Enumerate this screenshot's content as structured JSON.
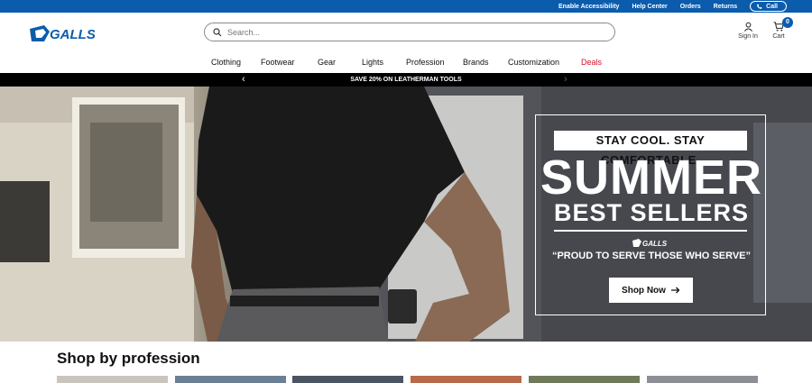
{
  "topbar": {
    "links": [
      "Enable Accessibility",
      "Help Center",
      "Orders",
      "Returns"
    ],
    "call_label": "Call"
  },
  "header": {
    "logo_text": "GALLS",
    "search_placeholder": "Search...",
    "signin_label": "Sign In",
    "cart_label": "Cart",
    "cart_count": "0"
  },
  "nav": {
    "items": [
      "Clothing",
      "Footwear",
      "Gear",
      "Lights",
      "Profession",
      "Brands",
      "Customization",
      "Deals"
    ],
    "deals_color": "#d0112b"
  },
  "promo": {
    "text": "SAVE 20% ON LEATHERMAN TOOLS"
  },
  "hero": {
    "tagline": "STAY COOL. STAY COMFORTABLE.",
    "headline": "SUMMER",
    "subheadline": "BEST SELLERS",
    "brand": "GALLS",
    "slogan": "“PROUD TO SERVE THOSE WHO SERVE”",
    "cta_label": "Shop Now"
  },
  "section": {
    "title": "Shop by profession"
  },
  "colors": {
    "brand_blue": "#0b5cad",
    "promo_bg": "#000000"
  }
}
